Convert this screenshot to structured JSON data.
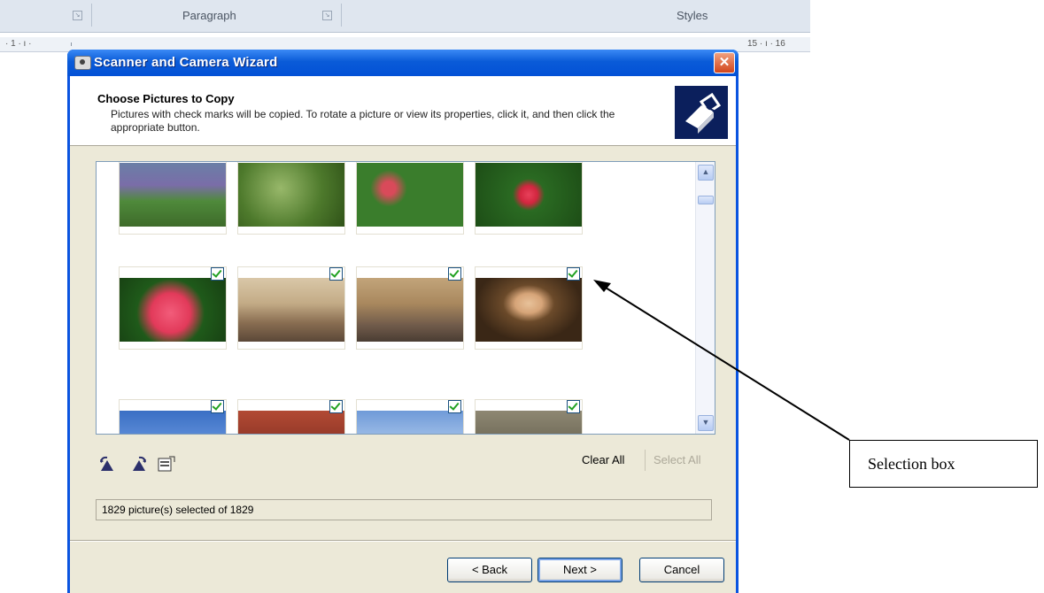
{
  "ribbon": {
    "group1": "Paragraph",
    "group2": "Styles"
  },
  "ruler": {
    "left_marks": "· 1 · ı ·",
    "right_marks": "15 · ı · 16"
  },
  "window": {
    "title": "Scanner and Camera Wizard",
    "close_glyph": "✕"
  },
  "header": {
    "heading": "Choose Pictures to Copy",
    "description": "Pictures with check marks will be copied. To rotate a picture or view its properties, click it, and then click the appropriate button."
  },
  "pictures": {
    "rows": [
      {
        "checked": [
          false,
          false,
          false,
          false
        ]
      },
      {
        "checked": [
          true,
          true,
          true,
          true
        ]
      },
      {
        "checked": [
          true,
          true,
          true,
          true
        ]
      }
    ]
  },
  "toolbar": {
    "rotate_left_icon": "rotate-left-icon",
    "rotate_right_icon": "rotate-right-icon",
    "properties_icon": "properties-icon",
    "clear_all": "Clear All",
    "select_all": "Select All"
  },
  "status": {
    "text": "1829 picture(s) selected of 1829"
  },
  "buttons": {
    "back": "< Back",
    "next": "Next >",
    "cancel": "Cancel"
  },
  "annotation": {
    "label": "Selection box"
  }
}
